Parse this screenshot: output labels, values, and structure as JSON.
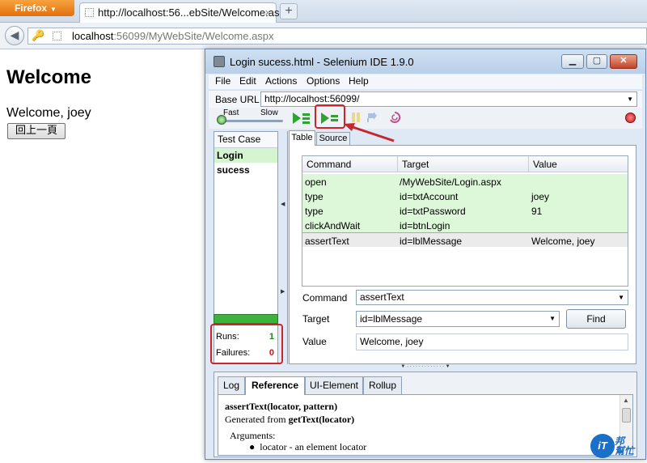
{
  "browser": {
    "menu_label": "Firefox",
    "tab_title": "http://localhost:56...ebSite/Welcome.aspx",
    "new_tab": "+",
    "url_host": "localhost",
    "url_rest": ":56099/MyWebSite/Welcome.aspx"
  },
  "page": {
    "heading": "Welcome",
    "message": "Welcome, joey",
    "back_button": "回上一頁"
  },
  "ide": {
    "title": "Login sucess.html - Selenium IDE 1.9.0",
    "menu": [
      "File",
      "Edit",
      "Actions",
      "Options",
      "Help"
    ],
    "base_url_label": "Base URL",
    "base_url_value": "http://localhost:56099/",
    "speed_fast": "Fast",
    "speed_slow": "Slow",
    "test_case_header": "Test Case",
    "test_case_item": "Login sucess",
    "runs_label": "Runs:",
    "runs_value": "1",
    "failures_label": "Failures:",
    "failures_value": "0",
    "tabs": [
      "Table",
      "Source"
    ],
    "columns": [
      "Command",
      "Target",
      "Value"
    ],
    "commands": [
      {
        "command": "open",
        "target": "/MyWebSite/Login.aspx",
        "value": ""
      },
      {
        "command": "type",
        "target": "id=txtAccount",
        "value": "joey"
      },
      {
        "command": "type",
        "target": "id=txtPassword",
        "value": "91"
      },
      {
        "command": "clickAndWait",
        "target": "id=btnLogin",
        "value": ""
      },
      {
        "command": "assertText",
        "target": "id=lblMessage",
        "value": "Welcome, joey"
      }
    ],
    "command_label": "Command",
    "command_value": "assertText",
    "target_label": "Target",
    "target_value": "id=lblMessage",
    "find_button": "Find",
    "value_label": "Value",
    "value_value": "Welcome, joey",
    "bottom_tabs": [
      "Log",
      "Reference",
      "UI-Element",
      "Rollup"
    ],
    "reference": {
      "signature": "assertText(locator, pattern)",
      "generated_prefix": "Generated from ",
      "generated_fn": "getText(locator)",
      "arguments_label": "Arguments:",
      "bullet": "locator - an element locator"
    }
  },
  "watermark": {
    "logo": "iT",
    "text_top": "邦",
    "text_bottom": "幫忙"
  },
  "colors": {
    "highlight": "#c8262b",
    "play_green": "#2fa32f",
    "runs_green": "#1a8a1a",
    "failures_red": "#c41a1a",
    "progress_green": "#3db23d",
    "executed_row": "#ddf7d9"
  },
  "icons": [
    "key-icon",
    "pause-icon",
    "step-icon",
    "rollup-icon",
    "record-icon"
  ]
}
